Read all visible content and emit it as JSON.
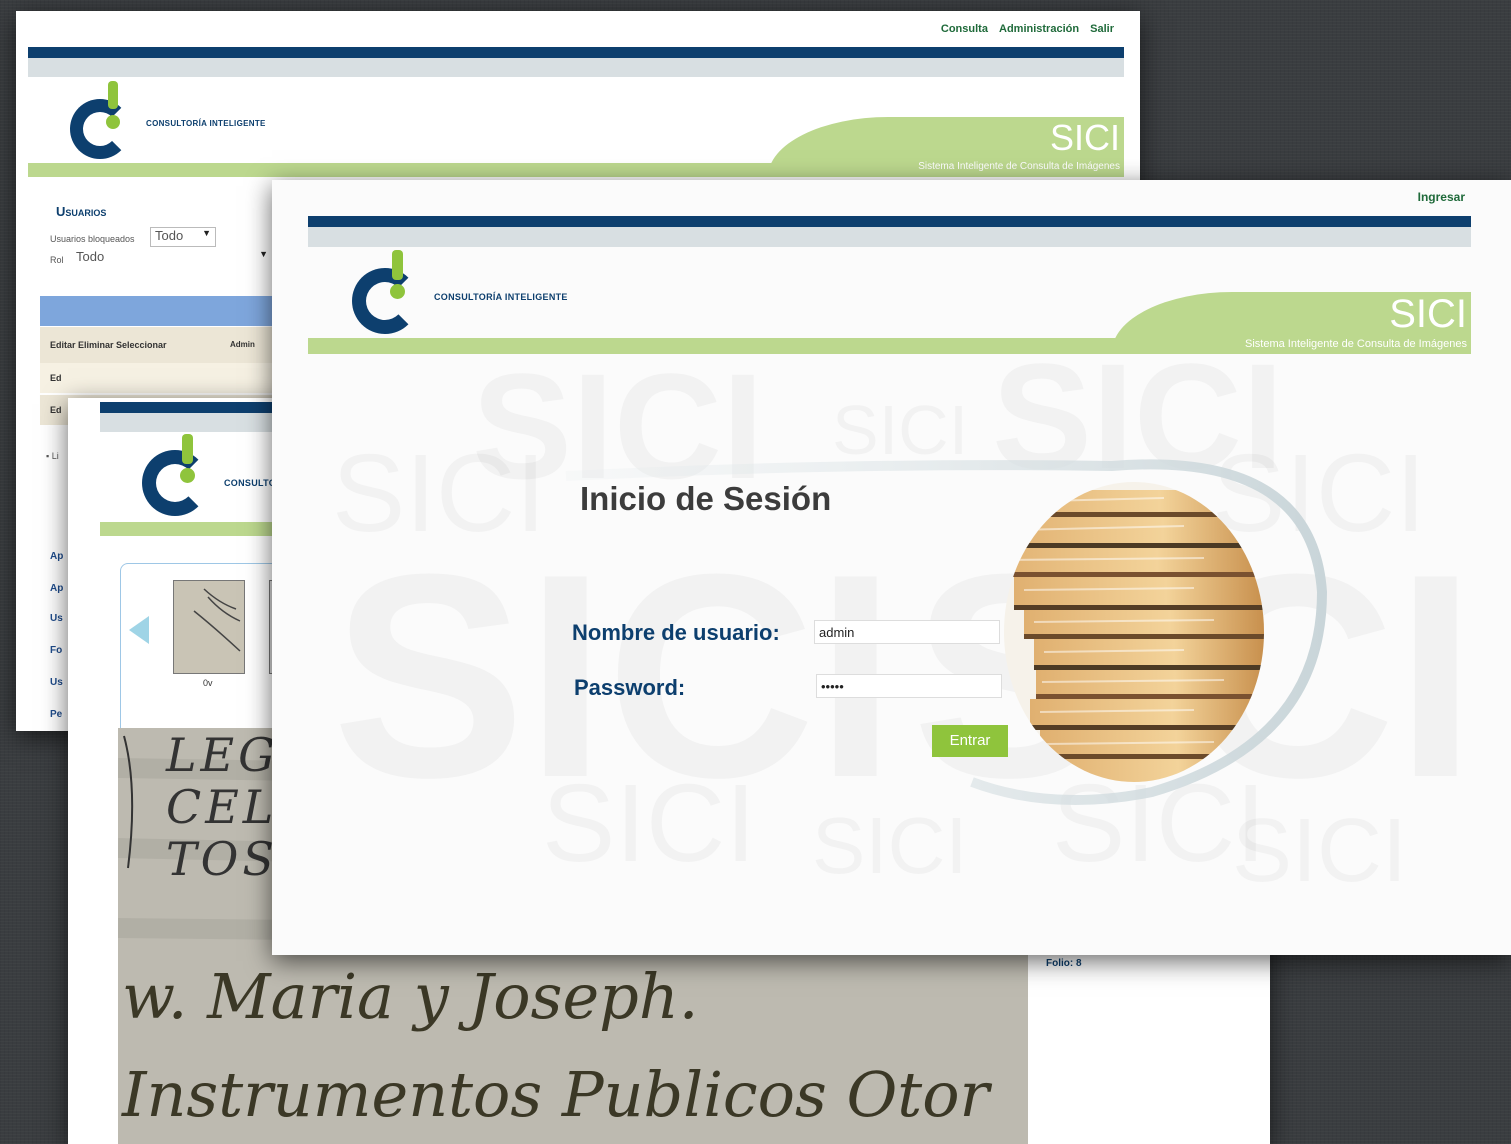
{
  "brand": {
    "logo_text": "CONSULTORÍA INTELIGENTE",
    "product": "SICI",
    "subtitle": "Sistema Inteligente de Consulta de Imágenes"
  },
  "admin_window": {
    "nav": [
      "Consulta",
      "Administración",
      "Salir"
    ],
    "section_title": "Usuarios",
    "filters": [
      {
        "label": "Usuarios bloqueados",
        "value": "Todo"
      },
      {
        "label": "Rol",
        "value": "Todo"
      }
    ],
    "table_header": "Editar Eliminar Seleccionar",
    "table_header_2": "Admin",
    "rows": [
      "Ed",
      "Ed"
    ],
    "side_items": [
      "Ap",
      "Ap",
      "Us",
      "Fo",
      "Us",
      "Pe"
    ]
  },
  "viewer_window": {
    "thumb_caption": "0v",
    "folio_label": "Folio: 8",
    "manuscript_lines": [
      "LEG",
      "CEL",
      "TOS",
      "w. Maria y Joseph.",
      "Instrumentos Publicos Otor"
    ]
  },
  "login_window": {
    "top_link": "Ingresar",
    "title": "Inicio de Sesión",
    "username_label": "Nombre de usuario:",
    "username_value": "admin",
    "password_label": "Password:",
    "password_value": "•••••",
    "submit_label": "Entrar",
    "watermark": "SICI"
  },
  "colors": {
    "navy": "#0d3f6e",
    "green": "#8fc43c",
    "light_green": "#bcd88e"
  }
}
